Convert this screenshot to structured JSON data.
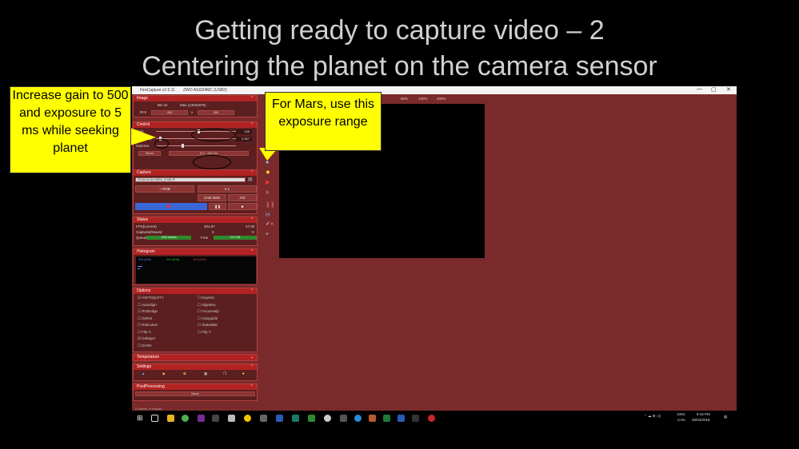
{
  "slide": {
    "title_line1": "Getting ready to capture video – 2",
    "title_line2": "Centering the planet on the camera sensor"
  },
  "callouts": {
    "left": "Increase gain to 500 and exposure to 5 ms while seeking planet",
    "right": "For Mars, use this exposure range"
  },
  "app": {
    "window_title": "FireCapture v2.5.11",
    "camera": "ZWO ASI224MC (USB2)",
    "window_buttons": {
      "min": "—",
      "max": "▢",
      "close": "✕"
    },
    "zoom_options": [
      "50%",
      "100%",
      "200%"
    ],
    "image_panel": {
      "header": "Image",
      "bin_label": "Bin 2x",
      "max_label": "Max (1304x976)",
      "roi_label": "ROI",
      "roi_w": "400",
      "roi_x": "x",
      "roi_h": "300"
    },
    "control_panel": {
      "header": "Control",
      "gain_label": "Gain",
      "gain_value": "345",
      "exposure_label": "Exp. (ms)",
      "exposure_value": "3.967",
      "gamma_label": "Gamma",
      "mode": "Mono",
      "exposure_range": "5.0 - 100 ms"
    },
    "capture_panel": {
      "header": "Capture",
      "filename": "2018-04-30-0834_3-MA-R",
      "btn_ser": "RGB",
      "btn_l": "L",
      "limit_label": "Limit 300s",
      "avi_label": "AVI"
    },
    "status_panel": {
      "header": "Status",
      "fps_label": "FPS(current)",
      "fps_value": "201.97",
      "fps_value2": "47.00",
      "captured_label": "Captured/Saved",
      "captured_value": "0",
      "captured_value2": "0",
      "queue_label": "Queue",
      "queue_bar": "1000 frames",
      "free_label": "Free",
      "free_bar": "21.5 GB"
    },
    "histogram_panel": {
      "header": "Histogram",
      "r": "R:0 (0%)",
      "g": "G:0 (0%)",
      "b": "B:0 (0%)"
    },
    "options_panel": {
      "header": "Options",
      "left": [
        "HISTOQUITY",
        "Autoalign",
        "RGBAlign",
        "DeRot",
        "Reticulum",
        "Flip X",
        "Debayer",
        "DARK"
      ],
      "right": [
        "ExpHist",
        "AlignBox",
        "FocusHelp",
        "Autoguide",
        "StatusBar",
        "Flip Y",
        "",
        ""
      ],
      "checked_left": [
        true,
        false,
        false,
        false,
        false,
        false,
        true,
        false
      ]
    },
    "temperature_panel": {
      "header": "Temperature"
    },
    "settings_panel": {
      "header": "Settings"
    },
    "postprocessing_panel": {
      "header": "PostProcessing",
      "value": "None"
    },
    "statusbar": "0 Frames / 0 dropped",
    "tray": {
      "lang": "ENG",
      "region": "CAN",
      "time": "9:19 PM",
      "date": "29/04/2018"
    }
  },
  "colors": {
    "app_bg": "#7a2a2a",
    "panel_header": "#b22222",
    "callout": "#ffff00"
  }
}
